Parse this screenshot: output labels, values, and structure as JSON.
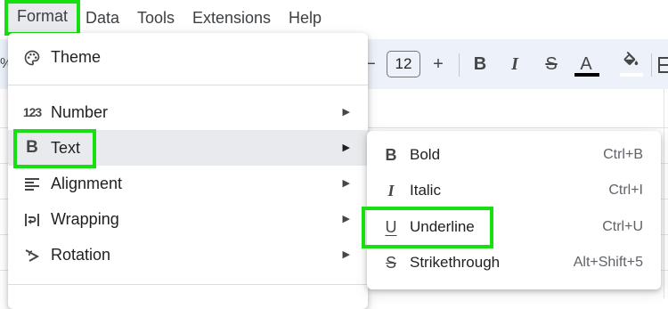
{
  "menubar": {
    "items": [
      "Format",
      "Data",
      "Tools",
      "Extensions",
      "Help"
    ]
  },
  "toolbar": {
    "minus_glyph": "−",
    "font_size": "12",
    "plus_glyph": "+",
    "bold_glyph": "B",
    "italic_glyph": "I",
    "strike_glyph": "S",
    "textcolor_glyph": "A",
    "percent_glyph": "%",
    "text_color": "#000000",
    "fill_color": "#ffffff"
  },
  "format_menu": {
    "items": [
      {
        "label": "Theme",
        "icon": "palette-icon"
      },
      {
        "label": "Number",
        "icon": "number-icon",
        "icon_text": "123",
        "submenu": true
      },
      {
        "label": "Text",
        "icon": "bold-b-icon",
        "icon_text": "B",
        "submenu": true
      },
      {
        "label": "Alignment",
        "icon": "align-left-icon",
        "submenu": true
      },
      {
        "label": "Wrapping",
        "icon": "wrap-icon",
        "submenu": true
      },
      {
        "label": "Rotation",
        "icon": "rotation-icon",
        "submenu": true
      }
    ]
  },
  "text_submenu": {
    "items": [
      {
        "label": "Bold",
        "shortcut": "Ctrl+B",
        "icon": "bold-icon",
        "icon_text": "B"
      },
      {
        "label": "Italic",
        "shortcut": "Ctrl+I",
        "icon": "italic-icon",
        "icon_text": "I"
      },
      {
        "label": "Underline",
        "shortcut": "Ctrl+U",
        "icon": "underline-icon",
        "icon_text": "U"
      },
      {
        "label": "Strikethrough",
        "shortcut": "Alt+Shift+5",
        "icon": "strikethrough-icon",
        "icon_text": "S"
      }
    ]
  },
  "highlight_color": "#16e00f"
}
